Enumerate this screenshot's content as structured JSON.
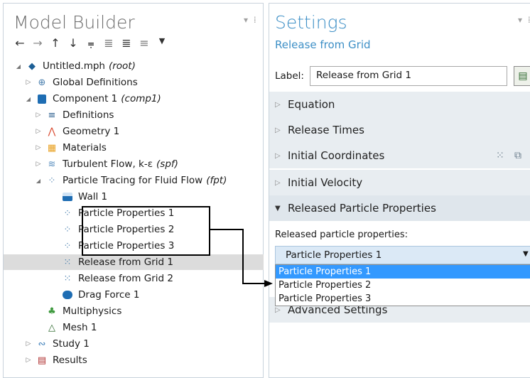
{
  "model_builder": {
    "title": "Model Builder",
    "tree": [
      {
        "label": "Untitled.mph",
        "tag": "(root)",
        "icon": "model-icon",
        "toggle": "▲"
      },
      {
        "label": "Global Definitions",
        "icon": "globe-icon",
        "toggle": "▷"
      },
      {
        "label": "Component 1",
        "tag": "(comp1)",
        "icon": "component-icon",
        "toggle": "▲"
      },
      {
        "label": "Definitions",
        "icon": "definitions-icon",
        "toggle": "▷"
      },
      {
        "label": "Geometry 1",
        "icon": "geometry-icon",
        "toggle": "▷"
      },
      {
        "label": "Materials",
        "icon": "materials-icon",
        "toggle": "▷"
      },
      {
        "label": "Turbulent Flow, k-ε",
        "tag": "(spf)",
        "icon": "turbulent-flow-icon",
        "toggle": "▷"
      },
      {
        "label": "Particle Tracing for Fluid Flow",
        "tag": "(fpt)",
        "icon": "particle-tracing-icon",
        "toggle": "▲"
      },
      {
        "label": "Wall 1",
        "icon": "wall-icon"
      },
      {
        "label": "Particle Properties 1",
        "icon": "particle-properties-icon"
      },
      {
        "label": "Particle Properties 2",
        "icon": "particle-properties-icon"
      },
      {
        "label": "Particle Properties 3",
        "icon": "particle-properties-icon"
      },
      {
        "label": "Release from Grid 1",
        "icon": "release-grid-icon",
        "selected": true
      },
      {
        "label": "Release from Grid 2",
        "icon": "release-grid-icon"
      },
      {
        "label": "Drag Force 1",
        "icon": "drag-force-icon"
      },
      {
        "label": "Multiphysics",
        "icon": "multiphysics-icon"
      },
      {
        "label": "Mesh 1",
        "icon": "mesh-icon"
      },
      {
        "label": "Study 1",
        "icon": "study-icon",
        "toggle": "▷"
      },
      {
        "label": "Results",
        "icon": "results-icon",
        "toggle": "▷"
      }
    ]
  },
  "settings": {
    "title": "Settings",
    "subtitle": "Release from Grid",
    "label_caption": "Label:",
    "label_value": "Release from Grid 1",
    "sections": [
      "Equation",
      "Release Times",
      "Initial Coordinates",
      "Initial Velocity",
      "Released Particle Properties"
    ],
    "rpp_label": "Released particle properties:",
    "selected_value": "Particle Properties 1",
    "options": [
      "Particle Properties 1",
      "Particle Properties 2",
      "Particle Properties 3"
    ],
    "after_section": "Advanced Settings"
  },
  "colors": {
    "accent": "#3d8fc6",
    "selection": "#dcdcdc",
    "dropdown_active": "#3399ff"
  }
}
